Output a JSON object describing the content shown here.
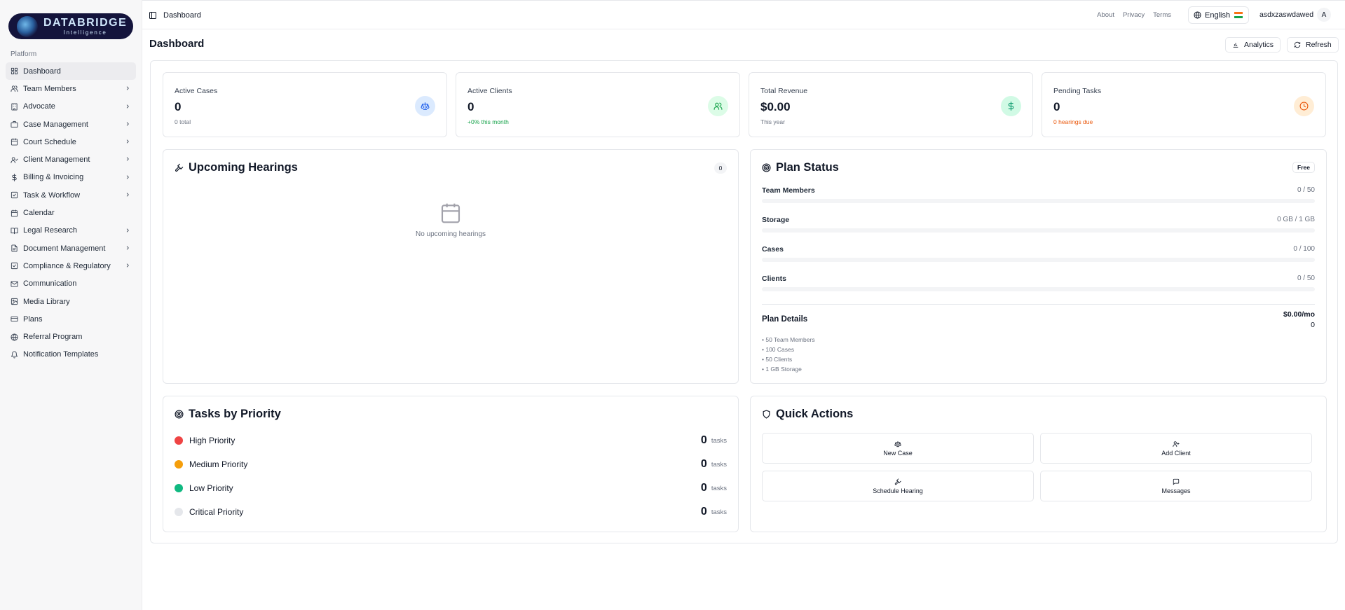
{
  "brand": {
    "name": "DATABRIDGE",
    "tagline": "Intelligence"
  },
  "sidebar": {
    "section": "Platform",
    "items": [
      {
        "label": "Dashboard",
        "icon": "grid-icon",
        "active": true,
        "expandable": false
      },
      {
        "label": "Team Members",
        "icon": "users-icon",
        "expandable": true
      },
      {
        "label": "Advocate",
        "icon": "building-icon",
        "expandable": true
      },
      {
        "label": "Case Management",
        "icon": "briefcase-icon",
        "expandable": true
      },
      {
        "label": "Court Schedule",
        "icon": "calendar-icon",
        "expandable": true
      },
      {
        "label": "Client Management",
        "icon": "user-check-icon",
        "expandable": true
      },
      {
        "label": "Billing & Invoicing",
        "icon": "dollar-icon",
        "expandable": true
      },
      {
        "label": "Task & Workflow",
        "icon": "check-square-icon",
        "expandable": true
      },
      {
        "label": "Calendar",
        "icon": "calendar-icon",
        "expandable": false
      },
      {
        "label": "Legal Research",
        "icon": "book-icon",
        "expandable": true
      },
      {
        "label": "Document Management",
        "icon": "file-icon",
        "expandable": true
      },
      {
        "label": "Compliance & Regulatory",
        "icon": "check-square-icon",
        "expandable": true
      },
      {
        "label": "Communication",
        "icon": "mail-icon",
        "expandable": false
      },
      {
        "label": "Media Library",
        "icon": "image-icon",
        "expandable": false
      },
      {
        "label": "Plans",
        "icon": "credit-card-icon",
        "expandable": false
      },
      {
        "label": "Referral Program",
        "icon": "globe-icon",
        "expandable": false
      },
      {
        "label": "Notification Templates",
        "icon": "bell-icon",
        "expandable": false
      }
    ]
  },
  "topbar": {
    "breadcrumb": "Dashboard",
    "links": [
      "About",
      "Privacy",
      "Terms"
    ],
    "language": "English",
    "username": "asdxzaswdawed",
    "avatar_initial": "A"
  },
  "page": {
    "title": "Dashboard",
    "analytics_label": "Analytics",
    "refresh_label": "Refresh"
  },
  "stats": [
    {
      "label": "Active Cases",
      "value": "0",
      "sub": "0 total",
      "icon": "scale-icon",
      "sub_color": "#6b7280",
      "icon_bg": "#dbeafe",
      "icon_color": "#2563eb"
    },
    {
      "label": "Active Clients",
      "value": "0",
      "sub": "+0% this month",
      "icon": "users-icon",
      "sub_color": "#16a34a",
      "icon_bg": "#dcfce7",
      "icon_color": "#16a34a"
    },
    {
      "label": "Total Revenue",
      "value": "$0.00",
      "sub": "This year",
      "icon": "dollar-icon",
      "sub_color": "#6b7280",
      "icon_bg": "#d1fae5",
      "icon_color": "#059669"
    },
    {
      "label": "Pending Tasks",
      "value": "0",
      "sub": "0 hearings due",
      "icon": "clock-icon",
      "sub_color": "#ea580c",
      "icon_bg": "#ffedd5",
      "icon_color": "#ea580c"
    }
  ],
  "hearings": {
    "title": "Upcoming Hearings",
    "count": "0",
    "empty_text": "No upcoming hearings"
  },
  "plan": {
    "title": "Plan Status",
    "badge": "Free",
    "usage": [
      {
        "label": "Team Members",
        "value": "0 / 50",
        "fraction": 0
      },
      {
        "label": "Storage",
        "value": "0 GB / 1 GB",
        "fraction": 0
      },
      {
        "label": "Cases",
        "value": "0 / 100",
        "fraction": 0
      },
      {
        "label": "Clients",
        "value": "0 / 50",
        "fraction": 0
      }
    ],
    "details_title": "Plan Details",
    "price": "$0.00/mo",
    "details_count": "0",
    "features": [
      "• 50 Team Members",
      "• 100 Cases",
      "• 50 Clients",
      "• 1 GB Storage"
    ]
  },
  "tasks": {
    "title": "Tasks by Priority",
    "unit": "tasks",
    "rows": [
      {
        "name": "High Priority",
        "count": "0",
        "color": "#ef4444"
      },
      {
        "name": "Medium Priority",
        "count": "0",
        "color": "#f59e0b"
      },
      {
        "name": "Low Priority",
        "count": "0",
        "color": "#10b981"
      },
      {
        "name": "Critical Priority",
        "count": "0",
        "color": "#e5e7eb"
      }
    ]
  },
  "quick_actions": {
    "title": "Quick Actions",
    "buttons": [
      {
        "label": "New Case",
        "icon": "scale-icon"
      },
      {
        "label": "Add Client",
        "icon": "user-plus-icon"
      },
      {
        "label": "Schedule Hearing",
        "icon": "gavel-icon"
      },
      {
        "label": "Messages",
        "icon": "message-icon"
      }
    ]
  }
}
